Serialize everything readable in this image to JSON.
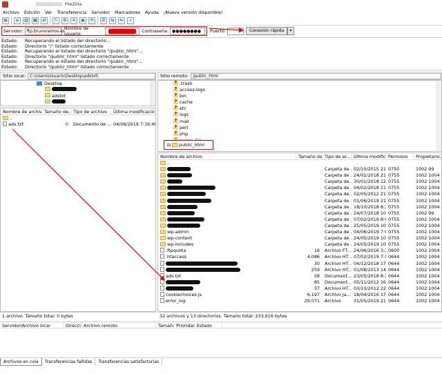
{
  "window": {
    "title": "FileZilla"
  },
  "menu": [
    "Archivo",
    "Edición",
    "Ver",
    "Transferencia",
    "Servidor",
    "Marcadores",
    "Ayuda",
    "¡Nueva versión disponible!"
  ],
  "quickconnect": {
    "server_label": "Servidor:",
    "server_value": "ftp.brunoramos.es",
    "user_label": "Nombre de usuario:",
    "password_label": "Contraseña:",
    "password_value": "●●●●●●●●",
    "port_label": "Puerto:",
    "port_value": "",
    "connect_button": "Conexión rápida",
    "dropdown": "▾"
  },
  "log": [
    {
      "k": "Estado:",
      "v": "Recuperando el listado del directorio..."
    },
    {
      "k": "Estado:",
      "v": "Directorio \"/\" listado correctamente"
    },
    {
      "k": "Estado:",
      "v": "Recuperando el listado del directorio \"/public_html\"..."
    },
    {
      "k": "Estado:",
      "v": "Directorio \"/public_html\" listado correctamente"
    },
    {
      "k": "Estado:",
      "v": "Recuperando el listado del directorio \"/public_html\"..."
    },
    {
      "k": "Estado:",
      "v": "Directorio \"/public_html\" listado correctamente"
    }
  ],
  "local": {
    "path_label": "Sitio local:",
    "path_value": "C:\\Users\\Usuario\\Desktop\\adstxt\\",
    "tree": {
      "desktop": "Desktop",
      "adstxt": "adstxt"
    },
    "columns": [
      "Nombre de archivo",
      "Tamaño de...",
      "Tipo de archivo",
      "Última modificación"
    ],
    "parent": "..",
    "file": {
      "name": "ads.txt",
      "size": "0",
      "type": "Documento de ...",
      "date": "04/06/2019 7:16:49"
    },
    "status": "1 archivo. Tamaño total: 0 bytes"
  },
  "remote": {
    "path_label": "Sitio remoto:",
    "path_value": "/public_html",
    "tree": [
      ".trash",
      "access-logs",
      "bin",
      "cache",
      "etc",
      "logs",
      "mail",
      "perl",
      "php",
      "public_ftp",
      "public_html"
    ],
    "columns": [
      "Nombre de archivo",
      "Tamaño de...",
      "Tipo de ar...",
      "Última modific...",
      "Permisos",
      "Propietario..."
    ],
    "parent": "..",
    "rows": [
      {
        "name": "",
        "size": "",
        "type": "Carpeta de ...",
        "date": "02/10/2015 21:...",
        "perm": "0750",
        "owner": "1002 99",
        "icon": "folder",
        "bar": 34
      },
      {
        "name": "",
        "size": "",
        "type": "Carpeta de ...",
        "date": "24/01/2018 21:...",
        "perm": "0755",
        "owner": "1002 1004",
        "icon": "folder",
        "bar": 36
      },
      {
        "name": "",
        "size": "",
        "type": "Carpeta de ...",
        "date": "30/01/2018 12:...",
        "perm": "0755",
        "owner": "1002 1004",
        "icon": "folder",
        "bar": 22
      },
      {
        "name": "",
        "size": "",
        "type": "Carpeta de ...",
        "date": "04/02/2018 11:...",
        "perm": "0755",
        "owner": "1002 1004",
        "icon": "folder",
        "bar": 70
      },
      {
        "name": "",
        "size": "",
        "type": "Carpeta de ...",
        "date": "02/05/2012 21:...",
        "perm": "0755",
        "owner": "1002 1004",
        "icon": "folder",
        "bar": 56
      },
      {
        "name": "",
        "size": "",
        "type": "Carpeta de ...",
        "date": "01/06/2019 21:...",
        "perm": "0755",
        "owner": "1002 1004",
        "icon": "folder",
        "bar": 64
      },
      {
        "name": "",
        "size": "",
        "type": "Carpeta de ...",
        "date": "18/10/2018 8:3...",
        "perm": "0755",
        "owner": "1002 1004",
        "icon": "folder",
        "bar": 44
      },
      {
        "name": "",
        "size": "",
        "type": "Carpeta de ...",
        "date": "24/07/2018 10:...",
        "perm": "0755",
        "owner": "1002 99",
        "icon": "folder",
        "bar": 40
      },
      {
        "name": "",
        "size": "",
        "type": "Carpeta de ...",
        "date": "07/02/2019 8:0...",
        "perm": "0755",
        "owner": "1002 1004",
        "icon": "folder",
        "bar": 54
      },
      {
        "name": "",
        "size": "",
        "type": "Carpeta de ...",
        "date": "25/05/2019 10:...",
        "perm": "0755",
        "owner": "1002 1004",
        "icon": "folder",
        "bar": 48
      },
      {
        "name": "wp-admin",
        "size": "",
        "type": "Carpeta de ...",
        "date": "04/06/2019 7:0...",
        "perm": "0755",
        "owner": "1002 1004",
        "icon": "folder",
        "bar": 0
      },
      {
        "name": "wp-content",
        "size": "",
        "type": "Carpeta de ...",
        "date": "24/05/2019 10:...",
        "perm": "0755",
        "owner": "1002 1004",
        "icon": "folder",
        "bar": 0
      },
      {
        "name": "wp-includes",
        "size": "",
        "type": "Carpeta de ...",
        "date": "24/05/2019 10:...",
        "perm": "0755",
        "owner": "1002 1004",
        "icon": "folder",
        "bar": 0
      },
      {
        "name": ".ftpquota",
        "size": "16",
        "type": "Archivo FT...",
        "date": "24/06/2016 3:3...",
        "perm": "0600",
        "owner": "1002 1004",
        "icon": "file",
        "bar": 0
      },
      {
        "name": ".htaccess",
        "size": "4,086",
        "type": "Archivo HT...",
        "date": "07/02/2019 7:5...",
        "perm": "0644",
        "owner": "1002 1004",
        "icon": "file",
        "bar": 0
      },
      {
        "name": "",
        "size": "30",
        "type": "Archivo HT...",
        "date": "04/12/2018 17:...",
        "perm": "0644",
        "owner": "1002 1004",
        "icon": "file",
        "bar": 104
      },
      {
        "name": "",
        "size": "259",
        "type": "Archivo HT...",
        "date": "01/08/2013 14:...",
        "perm": "0644",
        "owner": "1002 1004",
        "icon": "file",
        "bar": 108
      },
      {
        "name": "ads.txt",
        "size": "58",
        "type": "Document...",
        "date": "23/05/2018 8:3...",
        "perm": "0644",
        "owner": "1002 1004",
        "icon": "file",
        "bar": 0
      },
      {
        "name": "",
        "size": "85",
        "type": "Document...",
        "date": "05/11/2012 16:...",
        "perm": "0644",
        "owner": "1002 1004",
        "icon": "file",
        "bar": 50
      },
      {
        "name": "",
        "size": "37",
        "type": "Archivo HT...",
        "date": "03/10/2012 22:...",
        "perm": "0644",
        "owner": "1002 1004",
        "icon": "file",
        "bar": 40
      },
      {
        "name": "cookiechoices.js",
        "size": "6,197",
        "type": "Archivo Ja...",
        "date": "18/04/2016 17:...",
        "perm": "0644",
        "owner": "1002 1004",
        "icon": "file",
        "bar": 0
      },
      {
        "name": "error_log",
        "size": "29,071",
        "type": "Archivo",
        "date": "31/05/2019 21:...",
        "perm": "0644",
        "owner": "1002 1004",
        "icon": "file",
        "bar": 0
      }
    ],
    "status": "32 archivos y 13 directorios. Tamaño total: 233,616 bytes"
  },
  "queue": {
    "columns": [
      "Servidor/Archivo local",
      "Direcci...",
      "Archivo remoto",
      "Tamaño",
      "Prioridad",
      "Estado"
    ]
  },
  "tabs": [
    "Archivos en cola",
    "Transferencias fallidas",
    "Transferencias satisfactorias"
  ],
  "colors": {
    "highlight": "#e60000",
    "folder": "#f5d67a",
    "redaction": "#111111"
  }
}
